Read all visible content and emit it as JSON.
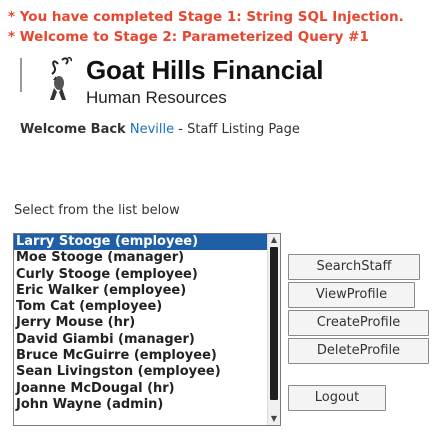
{
  "messages": [
    "* You have completed Stage 1: String SQL Injection.",
    "* Welcome to Stage 2: Parameterized Query #1"
  ],
  "header": {
    "company_name": "Goat Hills Financial",
    "department": "Human Resources"
  },
  "welcome": {
    "prefix": "Welcome Back",
    "user": "Neville",
    "suffix": " - Staff Listing Page"
  },
  "list": {
    "label": "Select from the list below",
    "selected_index": 0,
    "items": [
      "Larry Stooge (employee)",
      "Moe Stooge (manager)",
      "Curly Stooge (employee)",
      "Eric Walker (employee)",
      "Tom Cat (employee)",
      "Jerry Mouse (hr)",
      "David Giambi (manager)",
      "Bruce McGuirre (employee)",
      "Sean Livingston (employee)",
      "Joanne McDougal (hr)",
      "John Wayne (admin)"
    ]
  },
  "buttons": {
    "search": "SearchStaff",
    "view": "ViewProfile",
    "create": "CreateProfile",
    "delete": "DeleteProfile",
    "logout": "Logout"
  },
  "colors": {
    "message": "#e8462f",
    "selection": "#1f5fa8",
    "user_link": "#1a6fbf"
  }
}
